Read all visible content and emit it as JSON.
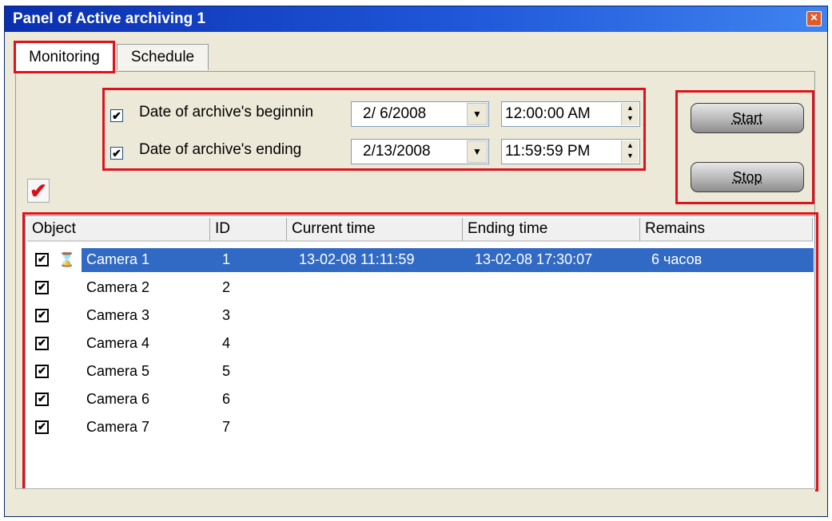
{
  "window": {
    "title": "Panel of Active archiving 1",
    "close_icon": "close-icon"
  },
  "tabs": [
    {
      "label": "Monitoring"
    },
    {
      "label": "Schedule"
    }
  ],
  "date_range": {
    "begin": {
      "checked": true,
      "label": "Date of archive's beginnin",
      "date": "2/ 6/2008",
      "time": "12:00:00 AM"
    },
    "end": {
      "checked": true,
      "label": "Date of archive's ending",
      "date": "2/13/2008",
      "time": "11:59:59 PM"
    }
  },
  "buttons": {
    "start": "Start",
    "stop": "Stop"
  },
  "table": {
    "columns": [
      "Object",
      "ID",
      "Current time",
      "Ending time",
      "Remains"
    ],
    "rows": [
      {
        "checked": true,
        "name": "Camera 1",
        "id": "1",
        "current_time": "13-02-08 11:11:59",
        "ending_time": "13-02-08 17:30:07",
        "remains": "6 часов",
        "selected": true,
        "status_icon": "hourglass-icon"
      },
      {
        "checked": true,
        "name": "Camera 2",
        "id": "2",
        "current_time": "",
        "ending_time": "",
        "remains": ""
      },
      {
        "checked": true,
        "name": "Camera 3",
        "id": "3",
        "current_time": "",
        "ending_time": "",
        "remains": ""
      },
      {
        "checked": true,
        "name": "Camera 4",
        "id": "4",
        "current_time": "",
        "ending_time": "",
        "remains": ""
      },
      {
        "checked": true,
        "name": "Camera 5",
        "id": "5",
        "current_time": "",
        "ending_time": "",
        "remains": ""
      },
      {
        "checked": true,
        "name": "Camera 6",
        "id": "6",
        "current_time": "",
        "ending_time": "",
        "remains": ""
      },
      {
        "checked": true,
        "name": "Camera 7",
        "id": "7",
        "current_time": "",
        "ending_time": "",
        "remains": ""
      }
    ]
  },
  "colors": {
    "title_bar": "#1f57d8",
    "selection": "#316ac5",
    "highlight_box": "#e0121b",
    "checkmark": "#d8101a"
  }
}
